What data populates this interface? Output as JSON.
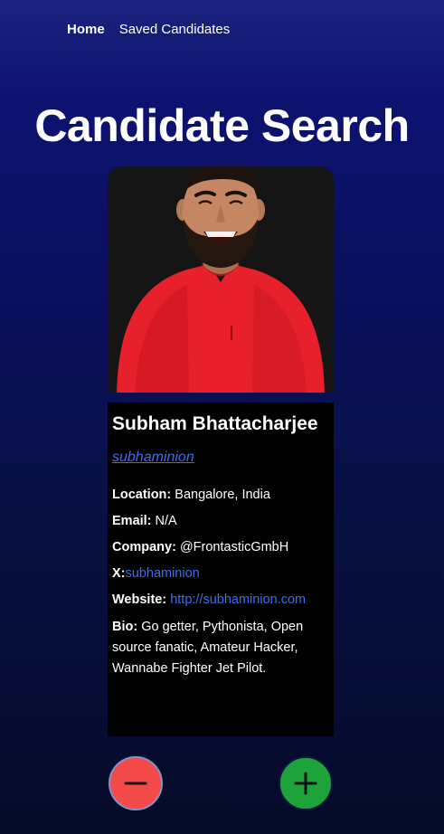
{
  "nav": {
    "home": "Home",
    "saved": "Saved Candidates"
  },
  "page": {
    "title": "Candidate Search"
  },
  "candidate": {
    "name": "Subham Bhattacharjee",
    "login": "subhaminion",
    "location_label": "Location:",
    "location": "Bangalore, India",
    "email_label": "Email:",
    "email": "N/A",
    "company_label": "Company:",
    "company": "@FrontasticGmbH",
    "x_label": "X:",
    "x": "subhaminion",
    "website_label": "Website:",
    "website": "http://subhaminion.com",
    "bio_label": "Bio:",
    "bio": "Go getter, Pythonista, Open source fanatic, Amateur Hacker, Wannabe Fighter Jet Pilot."
  },
  "actions": {
    "reject_icon": "minus-icon",
    "accept_icon": "plus-icon"
  },
  "colors": {
    "background": "#0a0f5e",
    "card": "#000000",
    "link": "#3d6ef0",
    "reject": "#f44a4a",
    "accept": "#1ea23a"
  }
}
